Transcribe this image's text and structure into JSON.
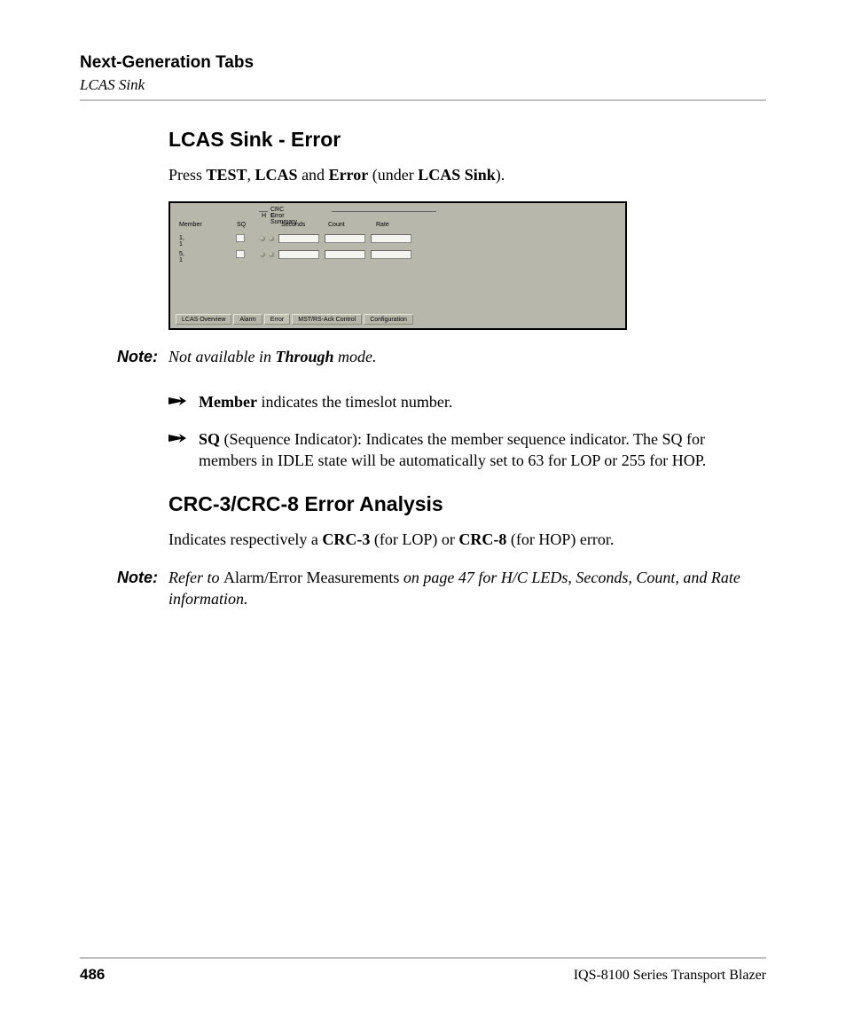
{
  "header": {
    "title": "Next-Generation Tabs",
    "subtitle": "LCAS Sink"
  },
  "section1": {
    "heading": "LCAS Sink - Error",
    "press_pre": "Press ",
    "press_b1": "TEST",
    "press_sep1": ", ",
    "press_b2": "LCAS",
    "press_sep2": " and ",
    "press_b3": "Error",
    "press_mid": " (under ",
    "press_b4": "LCAS Sink",
    "press_post": ")."
  },
  "ui": {
    "group_label": "CRC Error Summary",
    "hc_h": "H",
    "hc_c": "C",
    "cols": {
      "member": "Member",
      "sq": "SQ",
      "seconds": "Seconds",
      "count": "Count",
      "rate": "Rate"
    },
    "rows": [
      {
        "member": "1, 1"
      },
      {
        "member": "5, 1"
      }
    ],
    "tabs": [
      "LCAS Overview",
      "Alarm",
      "Error",
      "MST/RS-Ack Control",
      "Configuration"
    ]
  },
  "note1": {
    "label": "Note:",
    "pre": "Not available in ",
    "bold": "Through",
    "post": " mode."
  },
  "bullets": {
    "b1_bold": "Member",
    "b1_rest": " indicates the timeslot number.",
    "b2_bold": "SQ",
    "b2_rest": " (Sequence Indicator): Indicates the member sequence indicator. The SQ for members in IDLE state will be automatically set to 63 for LOP or 255 for HOP."
  },
  "section2": {
    "heading": "CRC-3/CRC-8 Error Analysis",
    "p_pre": "Indicates respectively a ",
    "p_b1": "CRC-3",
    "p_mid1": " (for LOP) or ",
    "p_b2": "CRC-8",
    "p_post": " (for HOP) error."
  },
  "note2": {
    "label": "Note:",
    "pre": "Refer to ",
    "upright": "Alarm/Error Measurements",
    "post": " on page 47 for H/C LEDs, Seconds, Count, and Rate information."
  },
  "footer": {
    "page": "486",
    "product": "IQS-8100 Series Transport Blazer"
  }
}
